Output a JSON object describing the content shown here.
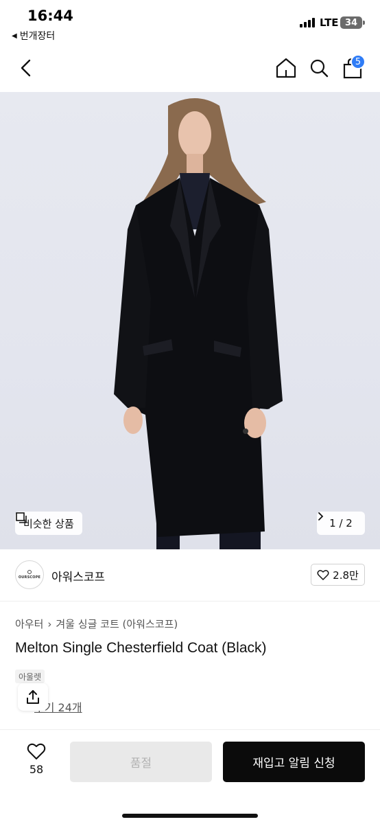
{
  "status": {
    "time": "16:44",
    "back_app": "번개장터",
    "network": "LTE",
    "battery": "34"
  },
  "nav": {
    "cart_count": "5"
  },
  "hero": {
    "similar_label": "비슷한 상품",
    "page_indicator": "1 / 2"
  },
  "store": {
    "logo_text": "OURSCOPE",
    "name": "아워스코프",
    "likes": "2.8만"
  },
  "product": {
    "breadcrumb": [
      "아우터",
      "겨울 싱글 코트 (아워스코프)"
    ],
    "title": "Melton Single Chesterfield Coat (Black)",
    "brand_tag": "아울렛",
    "review_text": "후기 24개"
  },
  "bottom": {
    "wish_count": "58",
    "soldout_label": "품절",
    "restock_label": "재입고 알림 신청"
  },
  "colors": {
    "accent_badge": "#2f7cf6",
    "primary_button": "#0b0b0b",
    "disabled_button": "#e9e9e9"
  }
}
